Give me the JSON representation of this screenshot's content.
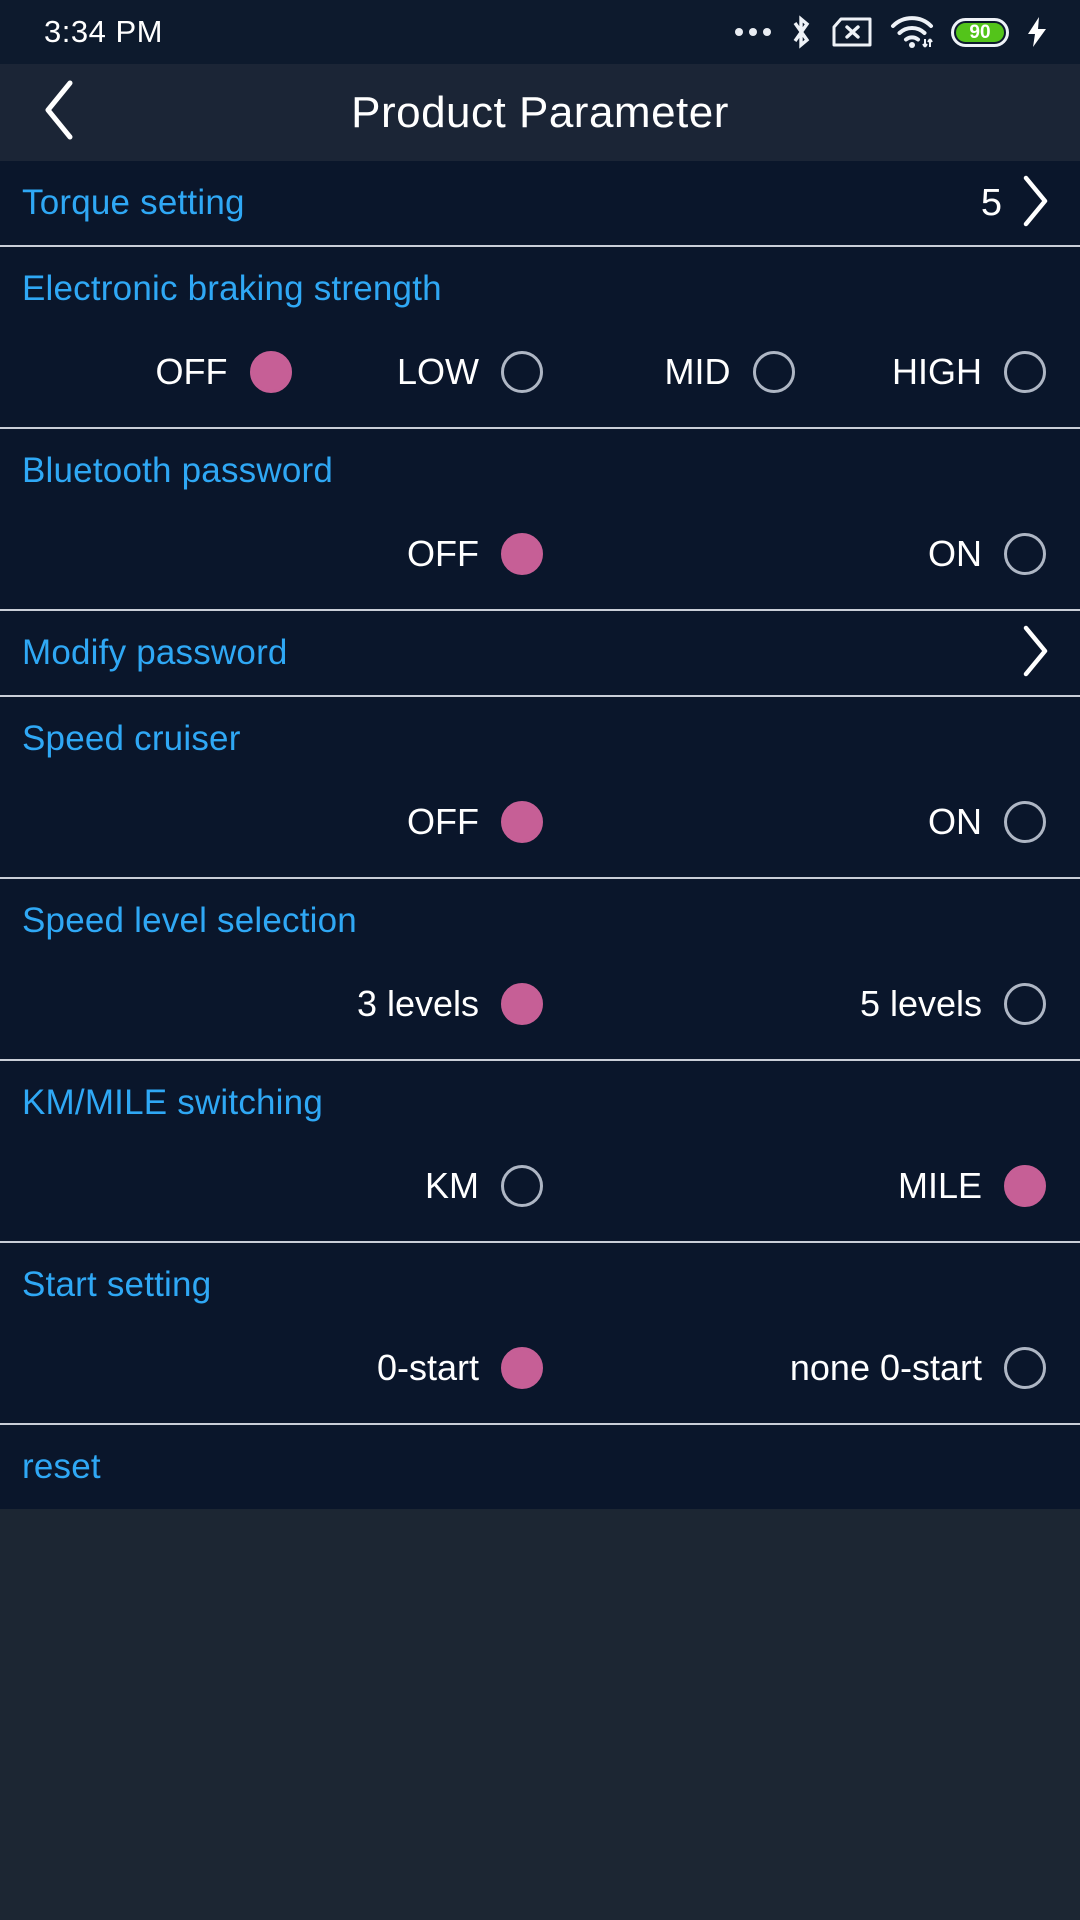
{
  "statusbar": {
    "time": "3:34 PM",
    "icons": [
      "more-dots-icon",
      "bluetooth-icon",
      "sim-card-off-icon",
      "wifi-icon",
      "battery-icon",
      "charging-bolt-icon"
    ],
    "battery_level": "90"
  },
  "header": {
    "title": "Product Parameter",
    "back_icon": "chevron-left-icon"
  },
  "colors": {
    "label": "#2fa8f5",
    "selected_radio": "#c65f96",
    "unselected_radio": "#aeb6c4",
    "list_bg": "#0a162b",
    "titlebar_bg": "#1b2536",
    "statusbar_bg": "#0d1a2d",
    "battery_fill": "#53c41a",
    "divider": "#c9ced8"
  },
  "rows": [
    {
      "type": "nav",
      "label": "Torque setting",
      "value": "5",
      "chevron": "chevron-right-icon"
    },
    {
      "type": "options",
      "label": "Electronic braking strength",
      "layout": "four",
      "options": [
        {
          "text": "OFF",
          "selected": true
        },
        {
          "text": "LOW",
          "selected": false
        },
        {
          "text": "MID",
          "selected": false
        },
        {
          "text": "HIGH",
          "selected": false
        }
      ]
    },
    {
      "type": "options",
      "label": "Bluetooth password",
      "layout": "two",
      "options": [
        {
          "text": "OFF",
          "selected": true
        },
        {
          "text": "ON",
          "selected": false
        }
      ]
    },
    {
      "type": "nav",
      "label": "Modify password",
      "value": "",
      "chevron": "chevron-right-icon"
    },
    {
      "type": "options",
      "label": "Speed cruiser",
      "layout": "two",
      "options": [
        {
          "text": "OFF",
          "selected": true
        },
        {
          "text": "ON",
          "selected": false
        }
      ]
    },
    {
      "type": "options",
      "label": "Speed level selection",
      "layout": "two",
      "options": [
        {
          "text": "3 levels",
          "selected": true
        },
        {
          "text": "5 levels",
          "selected": false
        }
      ]
    },
    {
      "type": "options",
      "label": "KM/MILE switching",
      "layout": "two",
      "options": [
        {
          "text": "KM",
          "selected": false
        },
        {
          "text": "MILE",
          "selected": true
        }
      ]
    },
    {
      "type": "options",
      "label": "Start setting",
      "layout": "two",
      "options": [
        {
          "text": "0-start",
          "selected": true
        },
        {
          "text": "none 0-start",
          "selected": false
        }
      ]
    },
    {
      "type": "plain",
      "label": "reset"
    }
  ]
}
